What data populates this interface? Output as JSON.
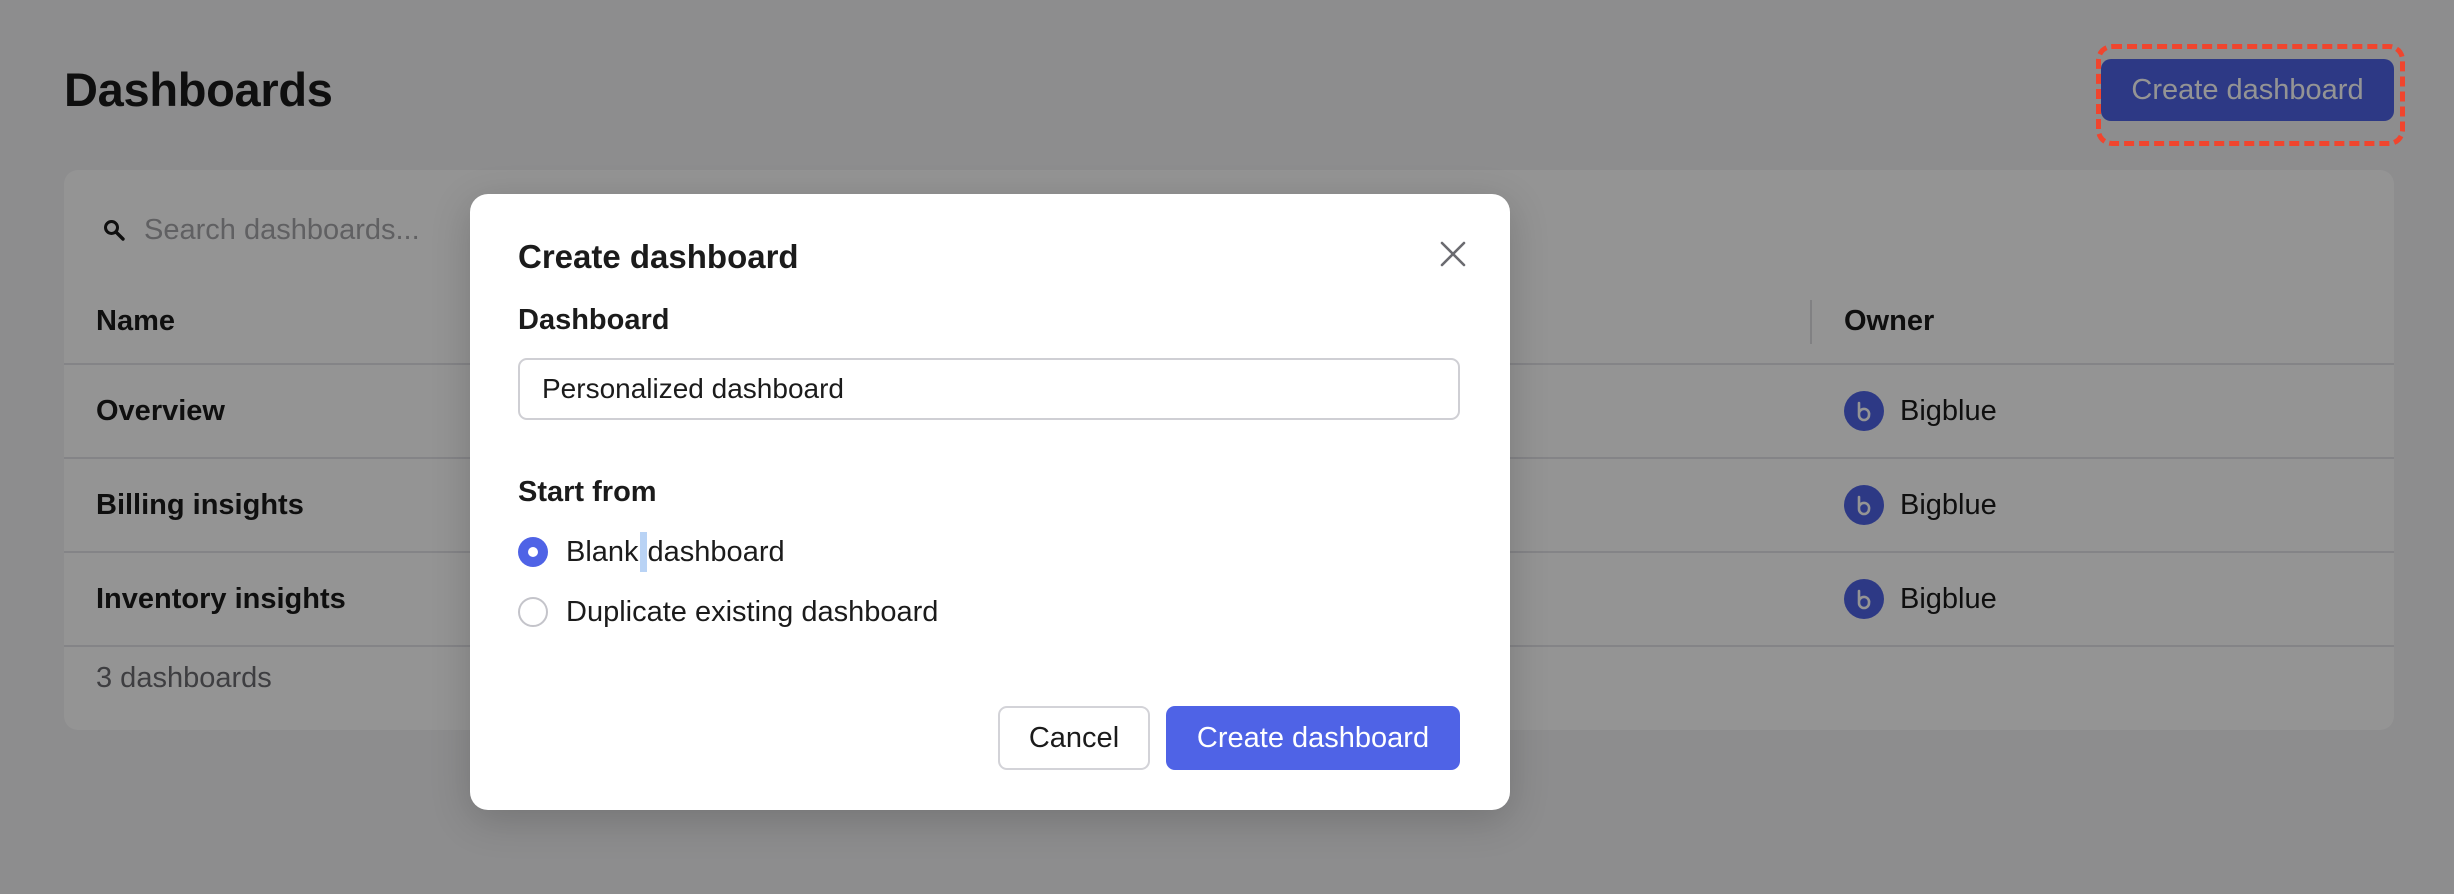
{
  "page": {
    "title": "Dashboards",
    "create_button_label": "Create dashboard"
  },
  "search": {
    "placeholder": "Search dashboards..."
  },
  "table": {
    "columns": [
      "Name",
      "Owner"
    ],
    "rows": [
      {
        "name": "Overview",
        "owner": "Bigblue"
      },
      {
        "name": "Billing insights",
        "owner": "Bigblue"
      },
      {
        "name": "Inventory insights",
        "owner": "Bigblue"
      }
    ],
    "footer": "3 dashboards"
  },
  "modal": {
    "title": "Create dashboard",
    "field_label": "Dashboard",
    "field_value": "Personalized dashboard",
    "start_from_label": "Start from",
    "options": [
      {
        "label_start": "Blank",
        "label_end": "dashboard",
        "selected": true
      },
      {
        "label": "Duplicate existing dashboard",
        "selected": false
      }
    ],
    "cancel_label": "Cancel",
    "submit_label": "Create dashboard"
  },
  "colors": {
    "accent": "#4f63e6",
    "highlight": "#f0452e",
    "overlay": "rgba(0,0,0,0.42)"
  },
  "icons": {
    "search": "search-icon",
    "close": "close-icon",
    "owner_avatar": "bigblue-logo-icon"
  }
}
